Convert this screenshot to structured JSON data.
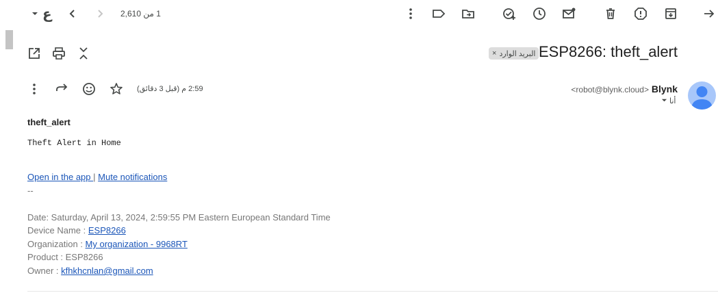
{
  "toolbar": {
    "pager_text": "1 من 2,610",
    "lang_glyph": "ع",
    "icons": [
      "dropdown-caret-icon",
      "older-icon",
      "newer-icon",
      "more-vert-icon",
      "label-icon",
      "move-to-icon",
      "add-to-tasks-icon",
      "snooze-icon",
      "mark-unread-icon",
      "delete-icon",
      "report-spam-icon",
      "archive-icon",
      "back-icon"
    ]
  },
  "message": {
    "subject": "ESP8266: theft_alert",
    "label_chip": "البريد الوارد",
    "label_close": "×",
    "sender_name": "Blynk",
    "sender_email": "<robot@blynk.cloud>",
    "to_label": "أنا",
    "time_text": "2:59 م (قبل 3 دقائق)"
  },
  "body": {
    "title": "theft_alert",
    "mono_line": "Theft Alert in Home",
    "open_in_app": "Open in the app ",
    "separator": "|",
    "mute": "Mute notifications",
    "dashes": "--",
    "date_line": "Date: Saturday, April 13, 2024, 2:59:55 PM Eastern European Standard Time",
    "device_label": "Device Name : ",
    "device_value": "ESP8266",
    "org_label": "Organization : ",
    "org_value": "My organization - 9968RT",
    "product_line": "Product : ESP8266",
    "owner_label": "Owner : ",
    "owner_value": "kfhkhcnlan@gmail.com"
  },
  "colors": {
    "link": "#1a55b8",
    "avatar_bg": "#a8c7fa",
    "avatar_fg": "#4285f4",
    "chip_bg": "#dddddd"
  }
}
